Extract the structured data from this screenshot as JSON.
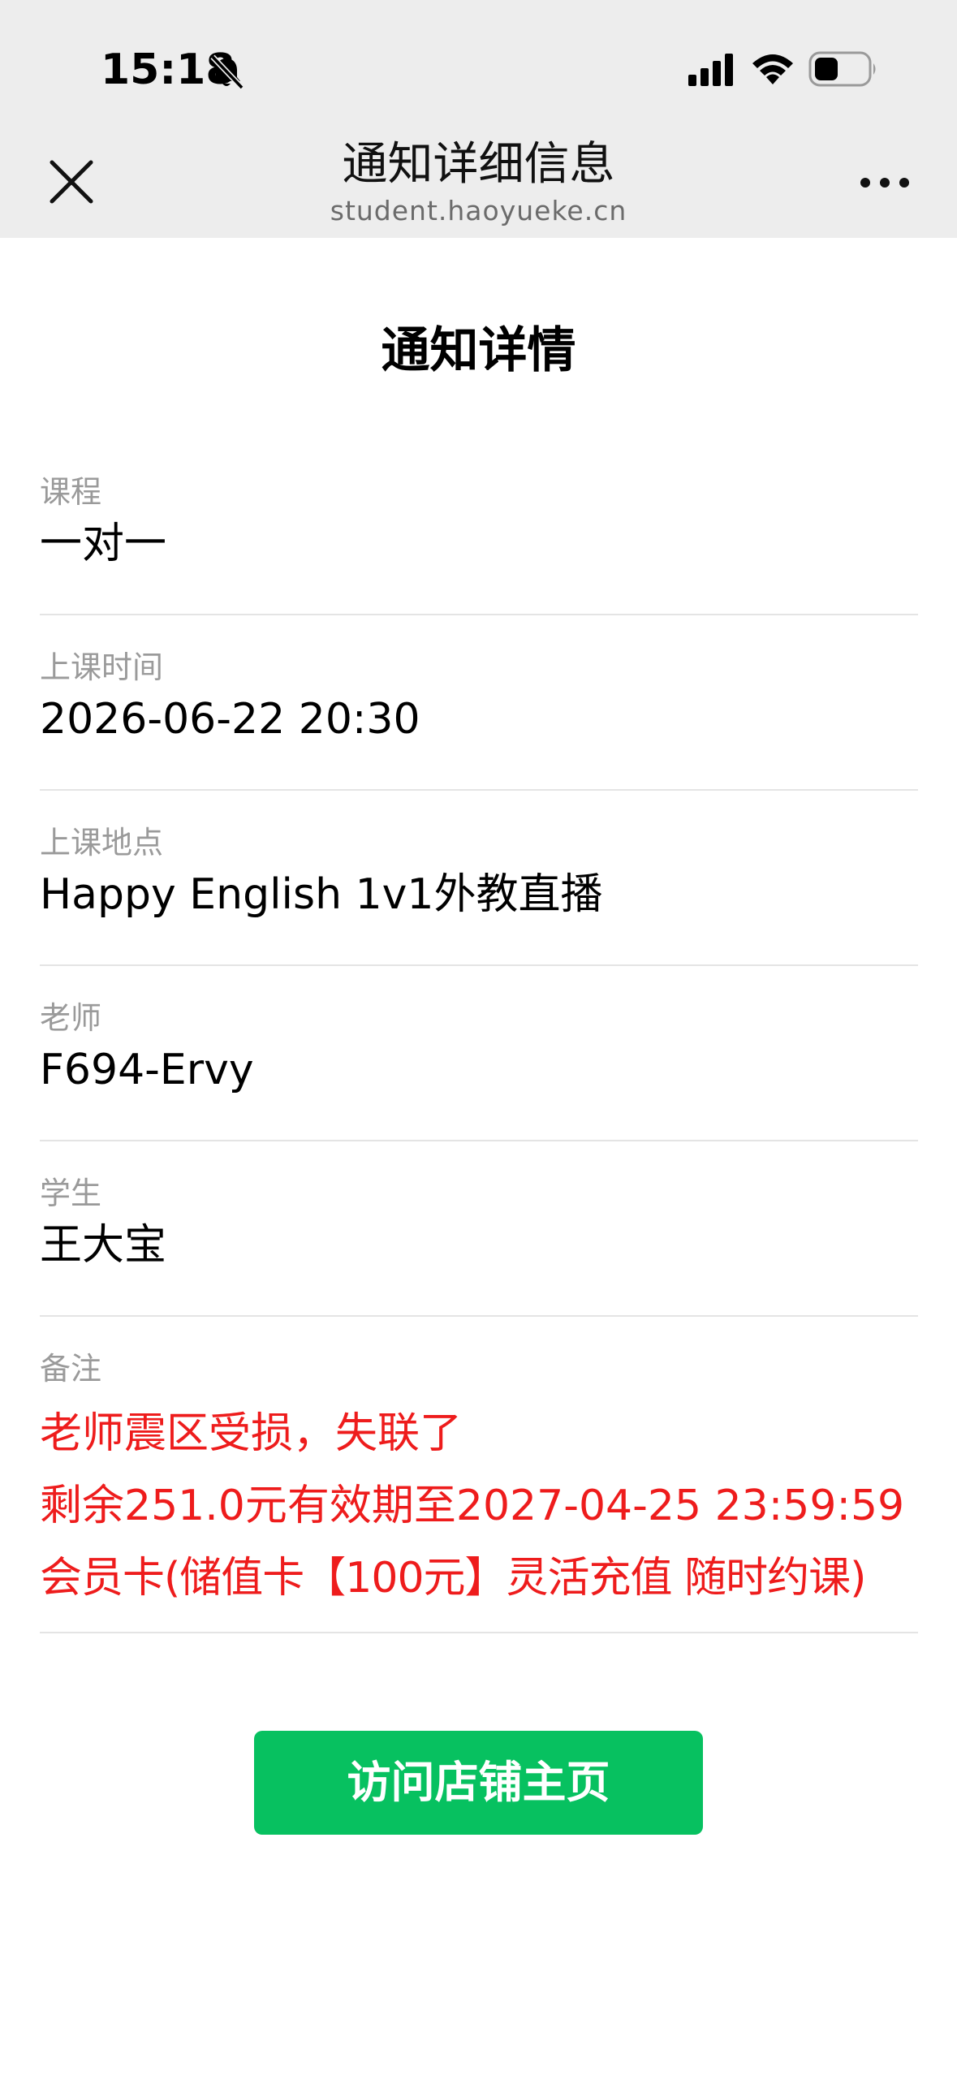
{
  "status_bar": {
    "time": "15:18",
    "icons": [
      "bell-slash-icon",
      "cellular-signal-icon",
      "wifi-icon",
      "battery-icon"
    ]
  },
  "nav": {
    "title": "通知详细信息",
    "subtitle": "student.haoyueke.cn",
    "close_icon": "close-icon",
    "more_icon": "more-icon"
  },
  "page": {
    "title": "通知详情"
  },
  "fields": {
    "course": {
      "label": "课程",
      "value": "一对一"
    },
    "time": {
      "label": "上课时间",
      "value": "2026-06-22 20:30"
    },
    "location": {
      "label": "上课地点",
      "value": "Happy English 1v1外教直播"
    },
    "teacher": {
      "label": "老师",
      "value": "F694-Ervy"
    },
    "student": {
      "label": "学生",
      "value": "王大宝"
    },
    "note": {
      "label": "备注",
      "lines": [
        "老师震区受损，失联了",
        "剩余251.0元有效期至2027-04-25 23:59:59",
        "会员卡(储值卡【100元】灵活充值 随时约课)"
      ]
    }
  },
  "button": {
    "label": "访问店铺主页"
  },
  "colors": {
    "accent": "#07c160",
    "note_text": "#ee1c1c",
    "header_bg": "#ededed"
  }
}
